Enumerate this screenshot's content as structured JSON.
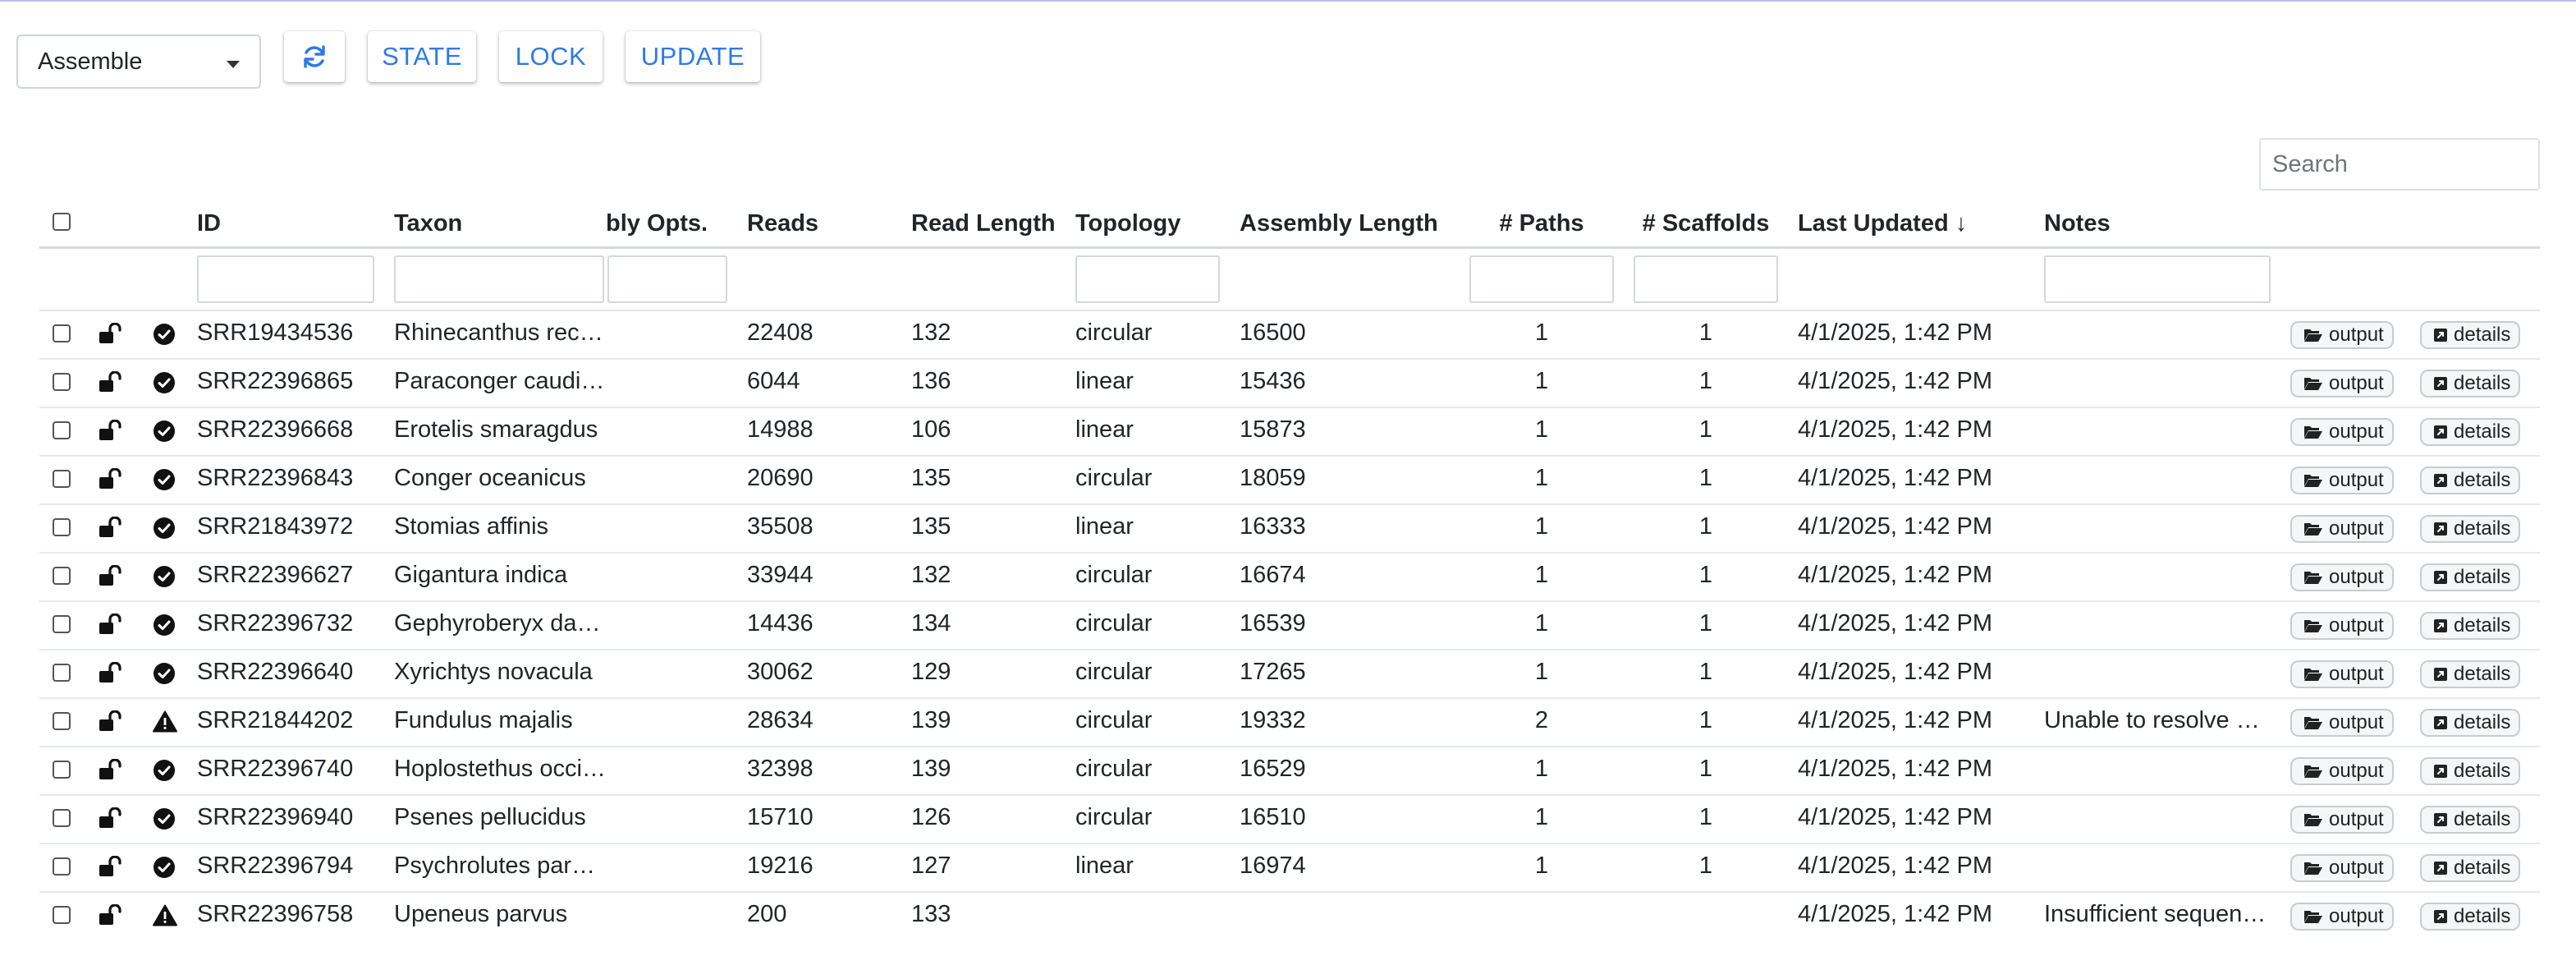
{
  "toolbar": {
    "mode_select": "Assemble",
    "refresh_icon": "refresh-icon",
    "state_label": "STATE",
    "lock_label": "LOCK",
    "update_label": "UPDATE"
  },
  "search": {
    "placeholder": "Search"
  },
  "table": {
    "columns": {
      "id": "ID",
      "taxon": "Taxon",
      "assembly_opts": "bly Opts.",
      "reads": "Reads",
      "read_length": "Read Length",
      "topology": "Topology",
      "assembly_length": "Assembly Length",
      "paths": "# Paths",
      "scaffolds": "# Scaffolds",
      "last_updated": "Last Updated ↓",
      "notes": "Notes"
    },
    "button_labels": {
      "output": "output",
      "details": "details"
    },
    "rows": [
      {
        "id": "SRR19434536",
        "taxon": "Rhinecanthus rect…",
        "reads": "22408",
        "read_length": "132",
        "topology": "circular",
        "assembly_length": "16500",
        "paths": "1",
        "scaffolds": "1",
        "last_updated": "4/1/2025, 1:42 PM",
        "notes": "",
        "status": "success"
      },
      {
        "id": "SRR22396865",
        "taxon": "Paraconger caudil…",
        "reads": "6044",
        "read_length": "136",
        "topology": "linear",
        "assembly_length": "15436",
        "paths": "1",
        "scaffolds": "1",
        "last_updated": "4/1/2025, 1:42 PM",
        "notes": "",
        "status": "success"
      },
      {
        "id": "SRR22396668",
        "taxon": "Erotelis smaragdus",
        "reads": "14988",
        "read_length": "106",
        "topology": "linear",
        "assembly_length": "15873",
        "paths": "1",
        "scaffolds": "1",
        "last_updated": "4/1/2025, 1:42 PM",
        "notes": "",
        "status": "success"
      },
      {
        "id": "SRR22396843",
        "taxon": "Conger oceanicus",
        "reads": "20690",
        "read_length": "135",
        "topology": "circular",
        "assembly_length": "18059",
        "paths": "1",
        "scaffolds": "1",
        "last_updated": "4/1/2025, 1:42 PM",
        "notes": "",
        "status": "success"
      },
      {
        "id": "SRR21843972",
        "taxon": "Stomias affinis",
        "reads": "35508",
        "read_length": "135",
        "topology": "linear",
        "assembly_length": "16333",
        "paths": "1",
        "scaffolds": "1",
        "last_updated": "4/1/2025, 1:42 PM",
        "notes": "",
        "status": "success"
      },
      {
        "id": "SRR22396627",
        "taxon": "Gigantura indica",
        "reads": "33944",
        "read_length": "132",
        "topology": "circular",
        "assembly_length": "16674",
        "paths": "1",
        "scaffolds": "1",
        "last_updated": "4/1/2025, 1:42 PM",
        "notes": "",
        "status": "success"
      },
      {
        "id": "SRR22396732",
        "taxon": "Gephyroberyx dar…",
        "reads": "14436",
        "read_length": "134",
        "topology": "circular",
        "assembly_length": "16539",
        "paths": "1",
        "scaffolds": "1",
        "last_updated": "4/1/2025, 1:42 PM",
        "notes": "",
        "status": "success"
      },
      {
        "id": "SRR22396640",
        "taxon": "Xyrichtys novacula",
        "reads": "30062",
        "read_length": "129",
        "topology": "circular",
        "assembly_length": "17265",
        "paths": "1",
        "scaffolds": "1",
        "last_updated": "4/1/2025, 1:42 PM",
        "notes": "",
        "status": "success"
      },
      {
        "id": "SRR21844202",
        "taxon": "Fundulus majalis",
        "reads": "28634",
        "read_length": "139",
        "topology": "circular",
        "assembly_length": "19332",
        "paths": "2",
        "scaffolds": "1",
        "last_updated": "4/1/2025, 1:42 PM",
        "notes": "Unable to resolve si…",
        "status": "warning"
      },
      {
        "id": "SRR22396740",
        "taxon": "Hoplostethus occi…",
        "reads": "32398",
        "read_length": "139",
        "topology": "circular",
        "assembly_length": "16529",
        "paths": "1",
        "scaffolds": "1",
        "last_updated": "4/1/2025, 1:42 PM",
        "notes": "",
        "status": "success"
      },
      {
        "id": "SRR22396940",
        "taxon": "Psenes pellucidus",
        "reads": "15710",
        "read_length": "126",
        "topology": "circular",
        "assembly_length": "16510",
        "paths": "1",
        "scaffolds": "1",
        "last_updated": "4/1/2025, 1:42 PM",
        "notes": "",
        "status": "success"
      },
      {
        "id": "SRR22396794",
        "taxon": "Psychrolutes para…",
        "reads": "19216",
        "read_length": "127",
        "topology": "linear",
        "assembly_length": "16974",
        "paths": "1",
        "scaffolds": "1",
        "last_updated": "4/1/2025, 1:42 PM",
        "notes": "",
        "status": "success"
      },
      {
        "id": "SRR22396758",
        "taxon": "Upeneus parvus",
        "reads": "200",
        "read_length": "133",
        "topology": "",
        "assembly_length": "",
        "paths": "",
        "scaffolds": "",
        "last_updated": "4/1/2025, 1:42 PM",
        "notes": "Insufficient sequen…",
        "status": "warning"
      }
    ]
  }
}
